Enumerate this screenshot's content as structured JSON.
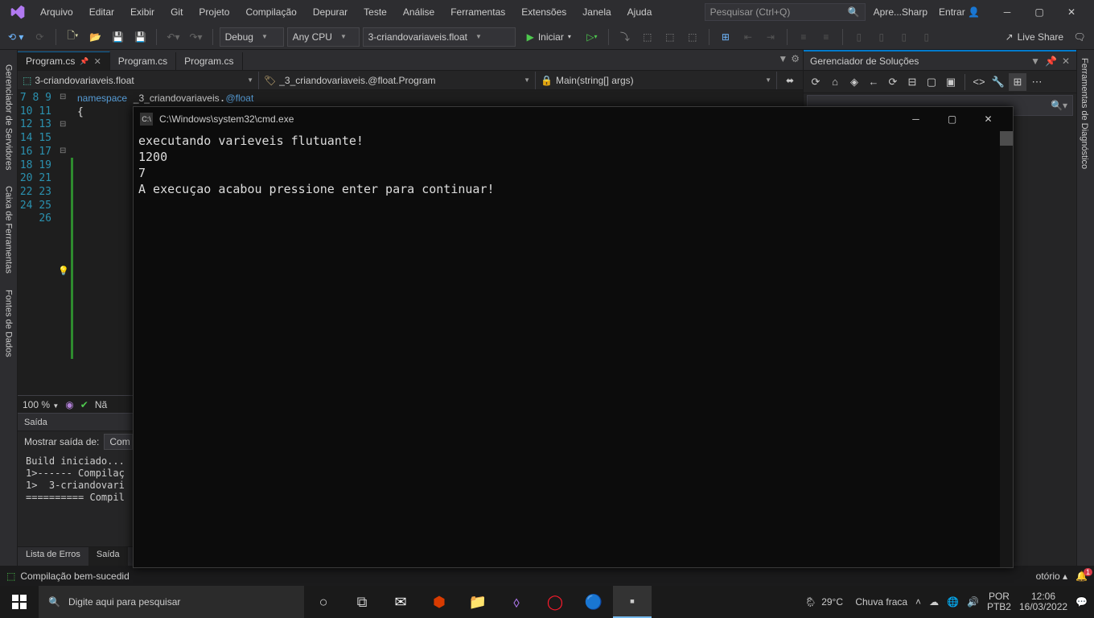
{
  "menu": [
    "Arquivo",
    "Editar",
    "Exibir",
    "Git",
    "Projeto",
    "Compilação",
    "Depurar",
    "Teste",
    "Análise",
    "Ferramentas",
    "Extensões",
    "Janela",
    "Ajuda"
  ],
  "search_placeholder": "Pesquisar (Ctrl+Q)",
  "promo": "Apre...Sharp",
  "signin": "Entrar",
  "toolbar": {
    "config": "Debug",
    "platform": "Any CPU",
    "project": "3-criandovariaveis.float",
    "start": "Iniciar",
    "liveshare": "Live Share"
  },
  "left_rails": [
    "Gerenciador de Servidores",
    "Caixa de Ferramentas",
    "Fontes de Dados"
  ],
  "right_rail": "Ferramentas de Diagnóstico",
  "tabs": [
    {
      "label": "Program.cs",
      "active": true
    },
    {
      "label": "Program.cs",
      "active": false
    },
    {
      "label": "Program.cs",
      "active": false
    }
  ],
  "nav": {
    "project": "3-criandovariaveis.float",
    "class": "_3_criandovariaveis.@float.Program",
    "member": "Main(string[] args)"
  },
  "code": {
    "line7": "namespace _3_criandovariaveis.@float",
    "line8": "{",
    "lines_start": 7,
    "lines_end": 26
  },
  "zoom": "100 %",
  "zoom_status": "Nã",
  "output": {
    "title": "Saída",
    "from_lbl": "Mostrar saída de:",
    "from_val": "Com",
    "lines": [
      "Build iniciado...",
      "1>------ Compilaç",
      "1>  3-criandovari",
      "========== Compil"
    ],
    "tabs": [
      "Lista de Erros",
      "Saída"
    ]
  },
  "solution": {
    "title": "Gerenciador de Soluções",
    "search_placeholder": ""
  },
  "status": {
    "left_icon": "✔",
    "text": "Compilação bem-sucedid",
    "right": "otório"
  },
  "console": {
    "title": "C:\\Windows\\system32\\cmd.exe",
    "lines": [
      "executando varieveis flutuante!",
      "1200",
      "7",
      "A execuçao acabou pressione enter para continuar!"
    ]
  },
  "taskbar": {
    "search": "Digite aqui para pesquisar",
    "weather_temp": "29°C",
    "weather_txt": "Chuva fraca",
    "lang1": "POR",
    "lang2": "PTB2",
    "time": "12:06",
    "date": "16/03/2022"
  },
  "notif_badge": "1"
}
